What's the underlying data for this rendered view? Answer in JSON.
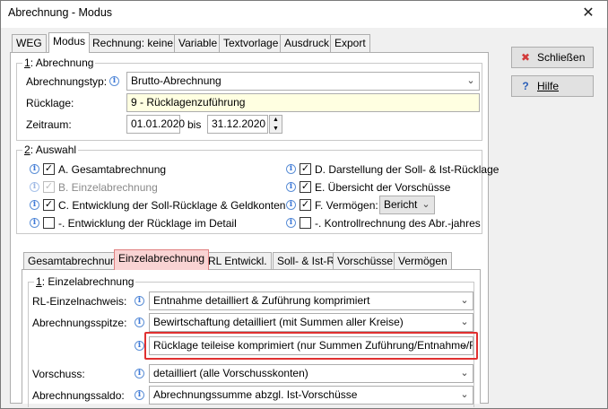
{
  "window": {
    "title": "Abrechnung - Modus"
  },
  "main_tabs": [
    "WEG",
    "Modus",
    "Rechnung: keine",
    "Variable",
    "Textvorlage",
    "Ausdruck",
    "Export"
  ],
  "side_buttons": {
    "close": "Schließen",
    "help": "Hilfe"
  },
  "section1": {
    "num": "1",
    "title": ": Abrechnung",
    "abrechnungstyp_label": "Abrechnungstyp:",
    "abrechnungstyp_value": "Brutto-Abrechnung",
    "ruecklage_label": "Rücklage:",
    "ruecklage_value": "9 - Rücklagenzuführung",
    "zeitraum_label": "Zeitraum:",
    "von": "01.01.2020",
    "bis_label": "bis",
    "bis": "31.12.2020"
  },
  "section2": {
    "num": "2",
    "title": ": Auswahl",
    "left": [
      {
        "text": "A.  Gesamtabrechnung",
        "checked": true,
        "disabled": false
      },
      {
        "text": "B.  Einzelabrechnung",
        "checked": true,
        "disabled": true
      },
      {
        "text": "C.  Entwicklung der Soll-Rücklage & Geldkonten",
        "checked": true,
        "disabled": false
      },
      {
        "text": "-.   Entwicklung der Rücklage im Detail",
        "checked": false,
        "disabled": false
      }
    ],
    "right": [
      {
        "text": "D.  Darstellung der Soll- & Ist-Rücklage",
        "checked": true
      },
      {
        "text": "E.  Übersicht der Vorschüsse",
        "checked": true
      },
      {
        "text": "F.  Vermögen:",
        "checked": true
      },
      {
        "text": "-.   Kontrollrechnung des Abr.-jahres",
        "checked": false
      }
    ],
    "vermoegen_value": "Bericht"
  },
  "sub_tabs": [
    "Gesamtabrechnung",
    "Einzelabrechnung",
    "RL Entwickl.",
    "Soll- & Ist-RL",
    "Vorschüsse",
    "Vermögen"
  ],
  "einzel": {
    "num": "1",
    "title": ": Einzelabrechnung",
    "rl_label": "RL-Einzelnachweis:",
    "rl_value": "Entnahme detailliert & Zuführung komprimiert",
    "spitze_label": "Abrechnungsspitze:",
    "spitze_value": "Bewirtschaftung detailliert (mit Summen aller Kreise)",
    "ruecklage_value": "Rücklage teileise komprimiert (nur Summen Zuführung/Entnahme/Fremd",
    "vorschuss_label": "Vorschuss:",
    "vorschuss_value": "detailliert (alle Vorschusskonten)",
    "saldo_label": "Abrechnungssaldo:",
    "saldo_value": "Abrechnungssumme abzgl. Ist-Vorschüsse"
  },
  "colors": {
    "highlight_border": "#e03030",
    "highlight_tab": "#f9d3d3",
    "info": "#3c78d8",
    "yellow_field": "#ffffe1"
  }
}
